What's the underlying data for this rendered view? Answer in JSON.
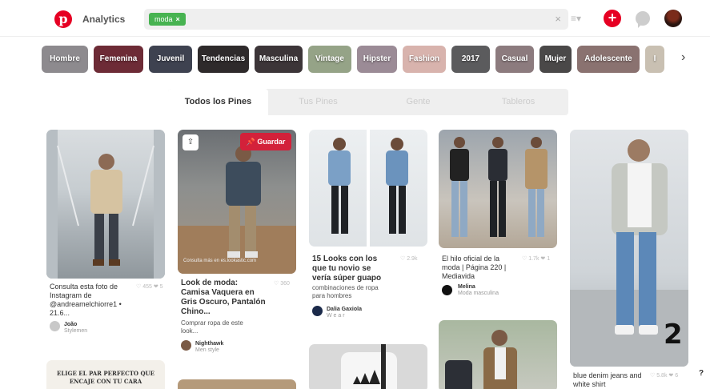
{
  "header": {
    "logo_letter": "p",
    "title": "Analytics",
    "search_chip": "moda",
    "search_chip_close": "×",
    "search_clear": "×",
    "list_icon": "list-icon",
    "plus_label": "+",
    "colors": {
      "brand": "#e60023",
      "chip": "#47b351"
    }
  },
  "categories": [
    {
      "label": "Hombre",
      "color": "#8d8a8e"
    },
    {
      "label": "Femenina",
      "color": "#6d2b36"
    },
    {
      "label": "Juvenil",
      "color": "#3e4250"
    },
    {
      "label": "Tendencias",
      "color": "#2e2a2b"
    },
    {
      "label": "Masculina",
      "color": "#3c3538"
    },
    {
      "label": "Vintage",
      "color": "#95a387"
    },
    {
      "label": "Hipster",
      "color": "#9b8b96"
    },
    {
      "label": "Fashion",
      "color": "#d8b3ad"
    },
    {
      "label": "2017",
      "color": "#5b5b5d"
    },
    {
      "label": "Casual",
      "color": "#8c7b7e"
    },
    {
      "label": "Mujer",
      "color": "#4a4848"
    },
    {
      "label": "Adolescente",
      "color": "#8a7270"
    },
    {
      "label": "I",
      "color": "#c9c0b2"
    }
  ],
  "tabs": [
    {
      "label": "Todos los Pines",
      "active": true
    },
    {
      "label": "Tus Pines",
      "active": false
    },
    {
      "label": "Gente",
      "active": false
    },
    {
      "label": "Tableros",
      "active": false
    }
  ],
  "pins": {
    "p1": {
      "title": "Consulta esta foto de Instagram de @andreamelchiorre1 • 21.6...",
      "meta": "♡ 455 ❤ 5",
      "pinner": "João",
      "pinner_sub": "Stylemen"
    },
    "p2": {
      "save": "Guardar",
      "credit": "Consulta más en es.lookastic.com",
      "title": "Look de moda: Camisa Vaquera en Gris Oscuro, Pantalón Chino...",
      "meta": "♡ 360",
      "desc": "Comprar ropa de este look...",
      "pinner": "Nighthawk",
      "pinner_sub": "Men style"
    },
    "p3": {
      "title": "15 Looks con los que tu novio se vería súper guapo",
      "meta": "♡ 2.9k",
      "desc": "combinaciones de ropa para hombres",
      "pinner": "Dalia Gaxiola",
      "pinner_sub": "W e a r"
    },
    "p4": {
      "title": "El hilo oficial de la moda | Página 220 | Mediavida",
      "meta": "♡ 1.7k ❤ 1",
      "pinner": "Melina",
      "pinner_sub": "Moda masculina"
    },
    "p5": {
      "title": "blue denim jeans and white shirt",
      "meta": "♡ 5.8k ❤ 6",
      "badge": "2"
    },
    "p6": {
      "quote": "ELIGE EL PAR PERFECTO QUE ENCAJE CON TU CARA"
    }
  },
  "help": "?"
}
